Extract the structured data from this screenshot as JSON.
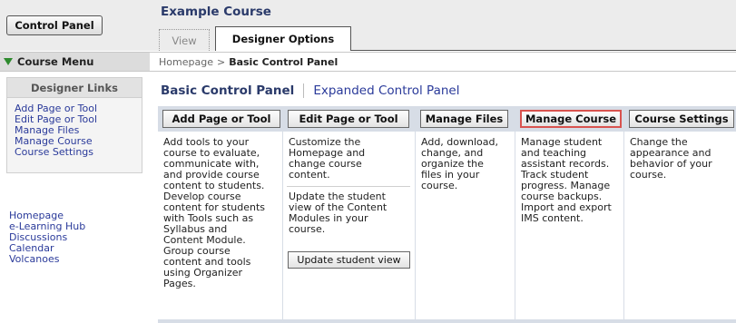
{
  "sidebar": {
    "control_panel_label": "Control Panel",
    "course_menu_label": "Course Menu",
    "designer_links_title": "Designer Links",
    "designer_links": [
      "Add Page or Tool",
      "Edit Page or Tool",
      "Manage Files",
      "Manage Course",
      "Course Settings"
    ],
    "course_links": [
      "Homepage",
      "e-Learning Hub",
      "Discussions",
      "Calendar",
      "Volcanoes"
    ]
  },
  "header": {
    "course_title": "Example Course",
    "tabs": [
      {
        "label": "View",
        "active": false
      },
      {
        "label": "Designer Options",
        "active": true
      }
    ]
  },
  "breadcrumb": {
    "home": "Homepage",
    "separator": ">",
    "current": "Basic Control Panel"
  },
  "panel": {
    "title": "Basic Control Panel",
    "alt_link": "Expanded Control Panel",
    "columns": [
      {
        "button": "Add Page or Tool",
        "lines": [
          "Add tools to your",
          "course to evaluate,",
          "communicate with,",
          "and provide course",
          "content to students.",
          "Develop course",
          "content for students",
          "with Tools such as",
          "Syllabus and",
          "Content Module.",
          "Group course",
          "content and tools",
          "using Organizer",
          "Pages."
        ]
      },
      {
        "button": "Edit Page or Tool",
        "lines": [
          "Customize the",
          "Homepage and",
          "change course",
          "content."
        ],
        "lines2": [
          "Update the student",
          "view of the Content",
          "Modules in your",
          "course."
        ],
        "extra_button": "Update student view"
      },
      {
        "button": "Manage Files",
        "lines": [
          "Add, download,",
          "change, and",
          "organize the",
          "files in your",
          "course."
        ]
      },
      {
        "button": "Manage Course",
        "active": true,
        "lines": [
          "Manage student",
          "and teaching",
          "assistant records.",
          "Track student",
          "progress. Manage",
          "course backups.",
          "Import and export",
          "IMS content."
        ]
      },
      {
        "button": "Course Settings",
        "lines": [
          "Change the",
          "appearance and",
          "behavior of your",
          "course."
        ]
      }
    ]
  },
  "colors": {
    "link": "#2a3a9a",
    "title": "#2a3a6a",
    "active_border": "#d9534f",
    "menu_arrow": "#2d8a2d"
  }
}
